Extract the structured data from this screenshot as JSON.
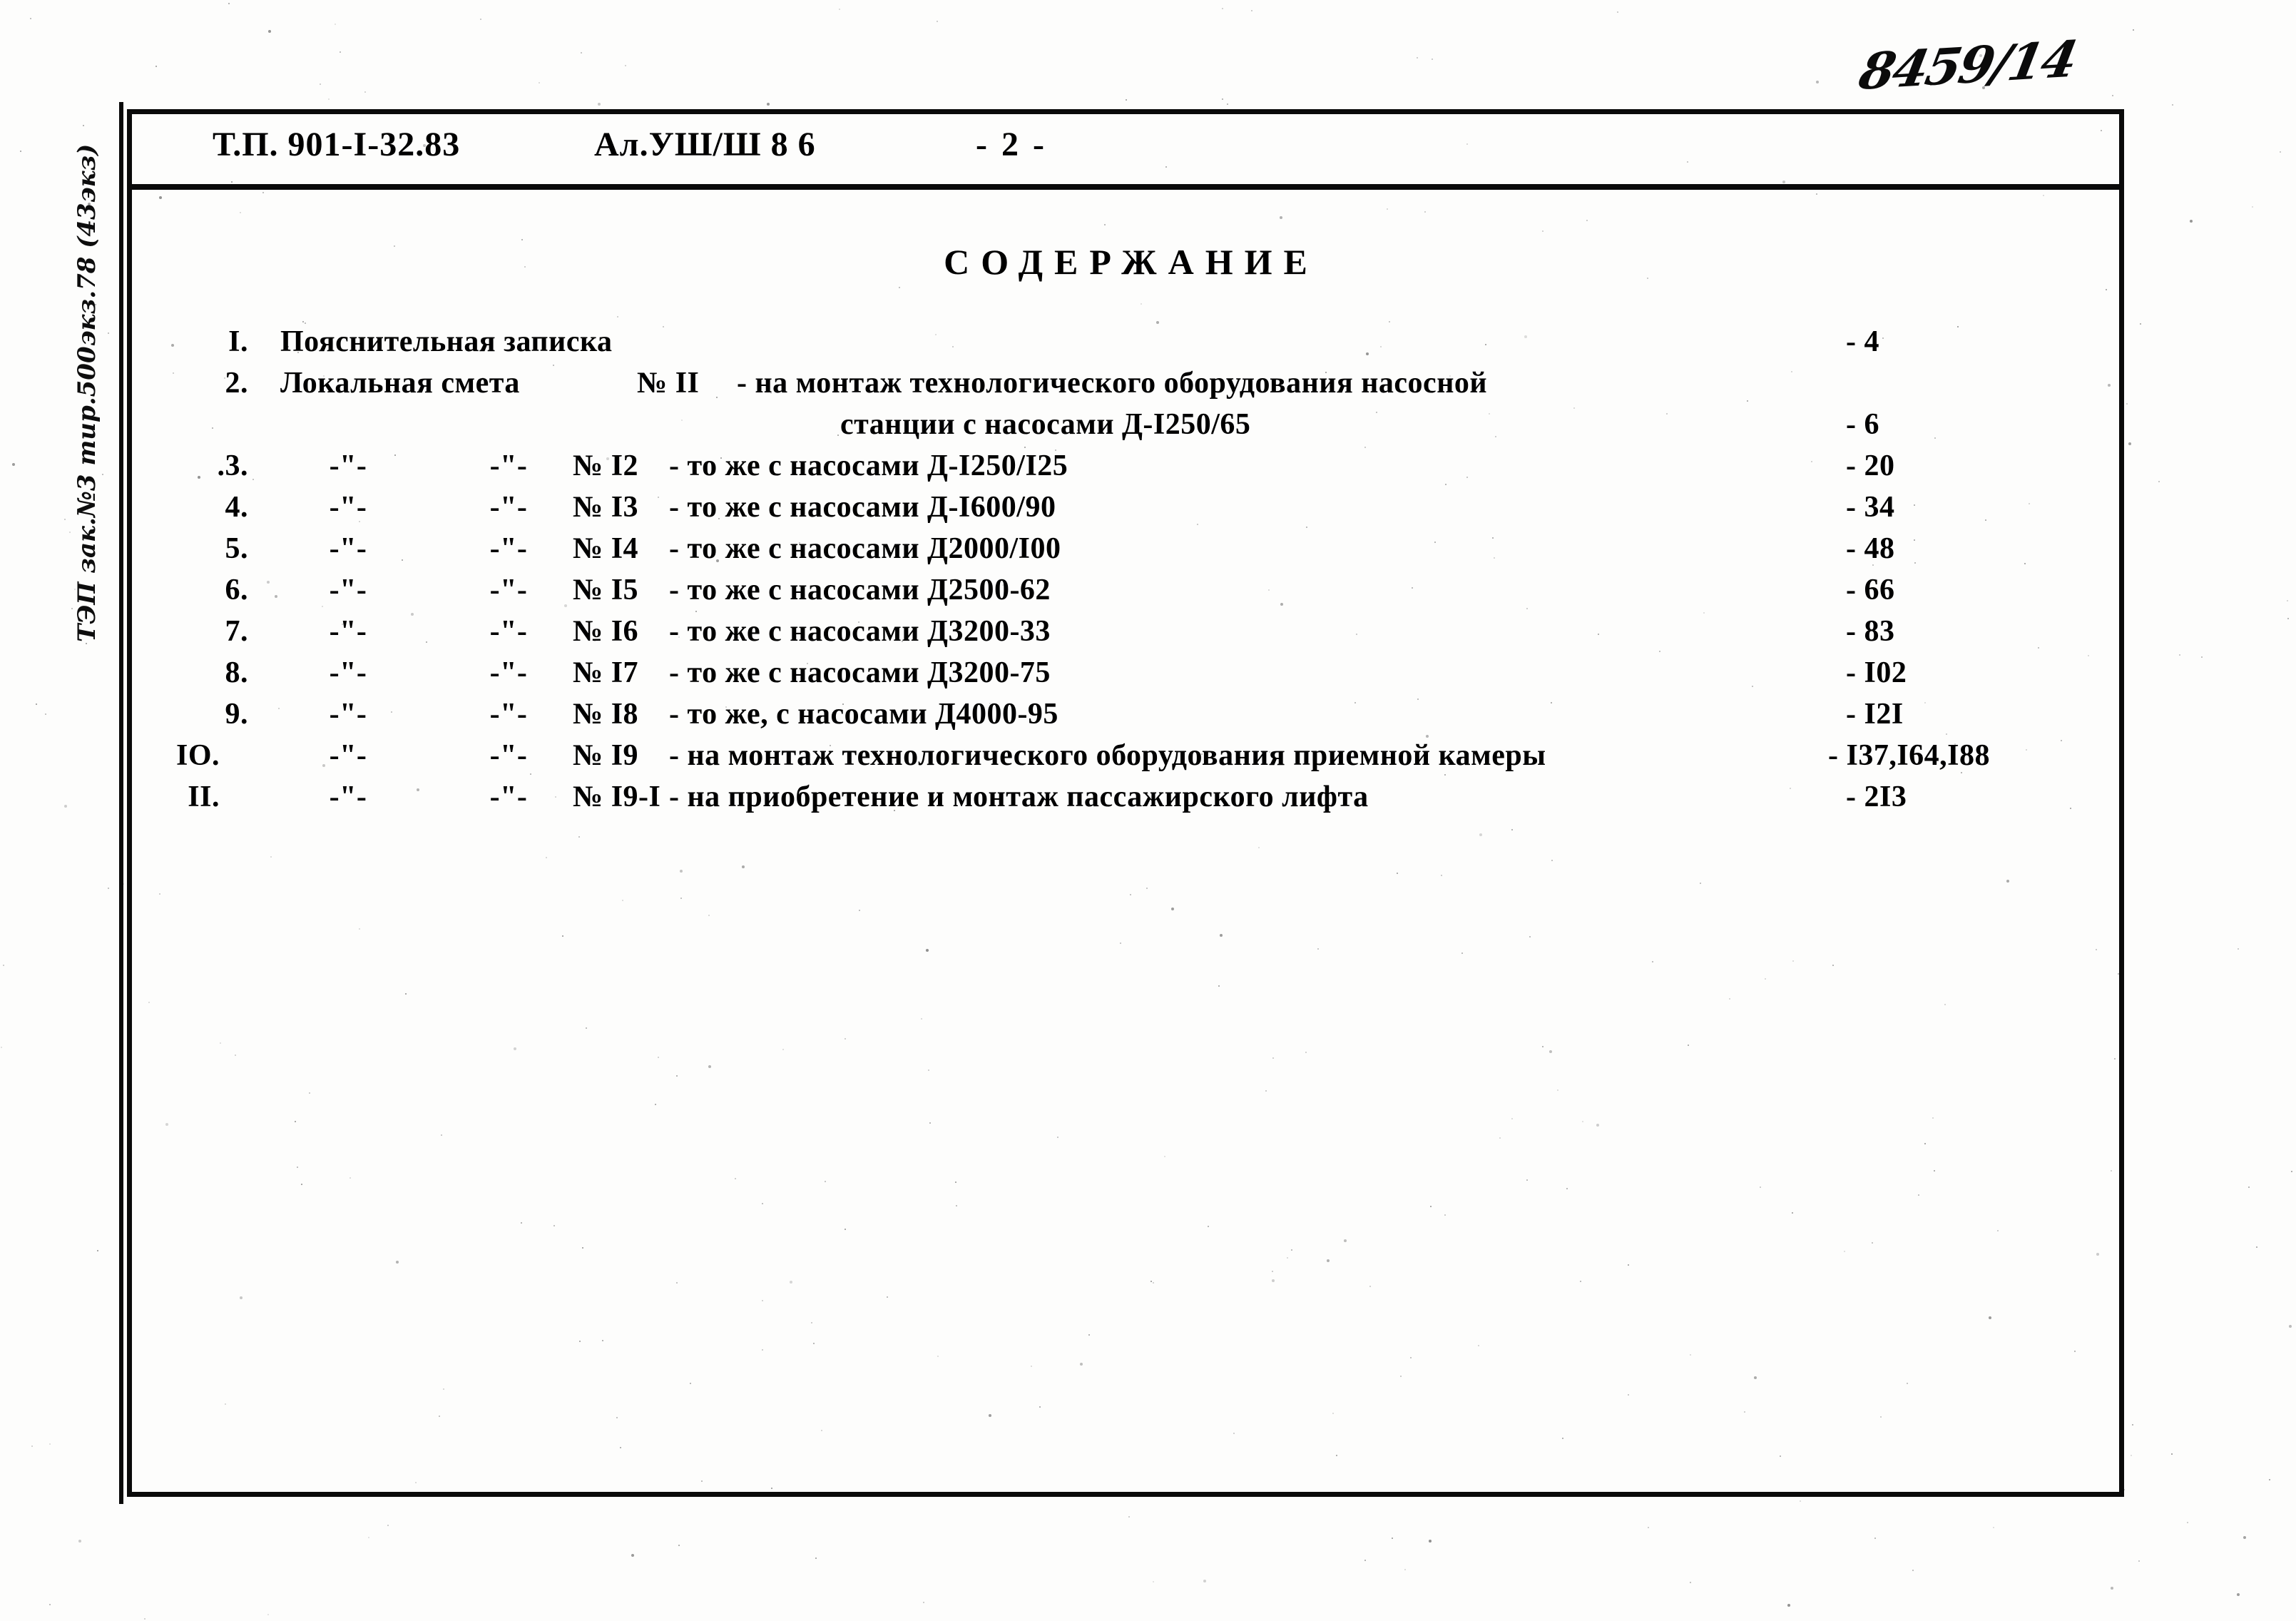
{
  "annotations": {
    "corner_number": "8459/14",
    "margin_note": "ТЭП зак.№3 тир.500экз.78 (43экз)"
  },
  "header": {
    "document_code": "Т.П. 901-I-32.83",
    "album": "Ал.УШ/Ш 8 6",
    "page_marker": "- 2 -"
  },
  "contents": {
    "title": "СОДЕРЖАНИЕ",
    "ditto": "-\"-",
    "number_sign": "№",
    "rows": [
      {
        "num": "I.",
        "title": "Пояснительная записка",
        "page": "- 4"
      },
      {
        "num": "2.",
        "label": "Локальная смета",
        "item_no": "№ II",
        "desc": "- на монтаж технологического оборудования насосной",
        "cont": "станции с насосами Д-I250/65",
        "page": "- 6"
      },
      {
        "num": ".3.",
        "item_no": "№ I2",
        "desc": "- то же с насосами Д-I250/I25",
        "page": "- 20"
      },
      {
        "num": "4.",
        "item_no": "№ I3",
        "desc": "- то же с насосами Д-I600/90",
        "page": "- 34"
      },
      {
        "num": "5.",
        "item_no": "№ I4",
        "desc": "- то же  с насосами Д2000/I00",
        "page": "- 48"
      },
      {
        "num": "6.",
        "item_no": "№ I5",
        "desc": "- то же  с насосами Д2500-62",
        "page": "- 66"
      },
      {
        "num": "7.",
        "item_no": "№ I6",
        "desc": "- то же  с насосами Д3200-33",
        "page": "- 83"
      },
      {
        "num": "8.",
        "item_no": "№ I7",
        "desc": "- то же  с насосами Д3200-75",
        "page": "- I02"
      },
      {
        "num": "9.",
        "item_no": "№ I8",
        "desc": "- то же, с насосами Д4000-95",
        "page": "- I2I"
      },
      {
        "num": "IO.",
        "item_no": "№ I9",
        "desc": "- на монтаж технологического оборудования приемной камеры",
        "page": "- I37,I64,I88"
      },
      {
        "num": "II.",
        "item_no": "№ I9-I",
        "desc": "- на приобретение и монтаж пассажирского лифта",
        "page": "- 2I3"
      }
    ]
  }
}
